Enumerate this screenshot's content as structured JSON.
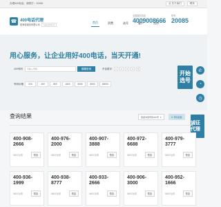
{
  "topbar": {
    "welcome": "办理400电话，请拨打：20085",
    "link1": "业 关于我们",
    "link2": "联系"
  },
  "header": {
    "logo_title": "400电话代理",
    "logo_sub": "纽海零通信有限公司",
    "logo_sub2": "www.5X3.cn",
    "nav": [
      "首页",
      "资费",
      "选号",
      "客户",
      "合作",
      "联系"
    ],
    "hotline_label": "全国服务热线",
    "hotline": "4009008666",
    "hotline2_label": "短号",
    "hotline2": "20085"
  },
  "banner": {
    "slogan": "用心服务，让企业用好400电话，当天开通!"
  },
  "search": {
    "label": "400号码",
    "placeholder": "可输入号码",
    "btn": "模糊查询",
    "exclude_label": "不含数字:",
    "digits": [
      "1",
      "2",
      "3",
      "4",
      "5"
    ],
    "price_label": "号码价格",
    "prices": [
      "220",
      "400",
      "800",
      "1600",
      "5000",
      "8000",
      "80000"
    ],
    "start": "开始选号"
  },
  "results": {
    "title": "查询结果",
    "sort1": "回避冲突号码400号",
    "sort2": "号码集数"
  },
  "cards": [
    {
      "num": "400-908-2666",
      "price": "5600元/年",
      "btn": "预选"
    },
    {
      "num": "400-976-2000",
      "price": "5600元/年",
      "btn": "预选"
    },
    {
      "num": "400-907-3888",
      "price": "5600元/年",
      "btn": "预选"
    },
    {
      "num": "400-972-6688",
      "price": "5600元/年",
      "btn": "预选"
    },
    {
      "num": "400-979-3777",
      "price": "5600元/年",
      "btn": "预选"
    },
    {
      "num": "400-936-1999",
      "price": "5600元/年",
      "btn": "预选"
    },
    {
      "num": "400-938-8777",
      "price": "5600元/年",
      "btn": "预选"
    },
    {
      "num": "400-933-2666",
      "price": "5600元/年",
      "btn": "预选"
    },
    {
      "num": "400-906-3000",
      "price": "5600元/年",
      "btn": "预选"
    },
    {
      "num": "400-952-1666",
      "price": "5600元/年",
      "btn": "预选"
    }
  ],
  "side": {
    "agent": "诚征代理"
  },
  "colors": {
    "accent": "#2e7fa3"
  }
}
